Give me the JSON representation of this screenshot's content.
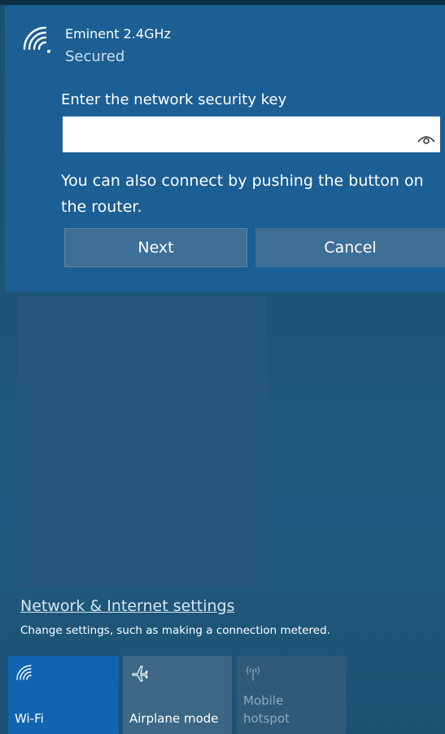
{
  "network": {
    "ssid": "Eminent 2.4GHz",
    "status": "Secured",
    "key_label": "Enter the network security key",
    "key_value": "",
    "push_button_text": "You can also connect by pushing the button on the router.",
    "next_label": "Next",
    "cancel_label": "Cancel"
  },
  "settings": {
    "link_label": "Network & Internet settings",
    "description": "Change settings, such as making a connection metered."
  },
  "quick_actions": [
    {
      "label": "Wi-Fi",
      "icon": "wifi-icon",
      "state": "on"
    },
    {
      "label": "Airplane mode",
      "icon": "airplane-icon",
      "state": "off"
    },
    {
      "label": "Mobile hotspot",
      "icon": "hotspot-icon",
      "state": "disabled"
    }
  ],
  "colors": {
    "panel": "#1b5f94",
    "wifi_tile_active": "#1064b0",
    "background": "#1d5478"
  }
}
